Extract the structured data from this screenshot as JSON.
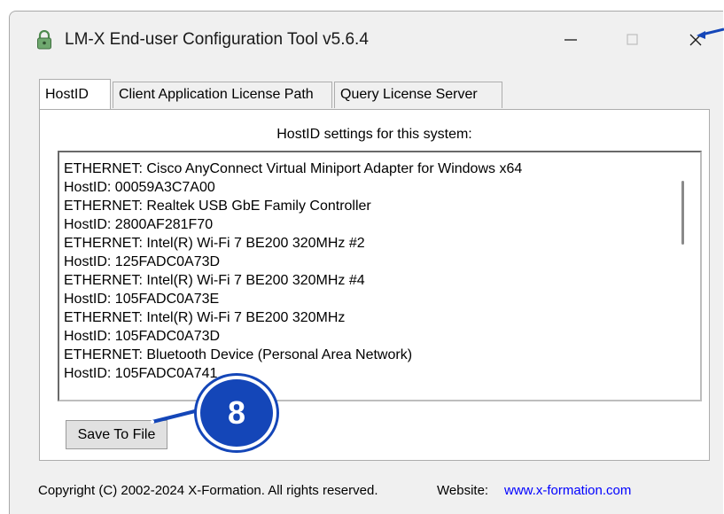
{
  "window": {
    "title": "LM-X End-user Configuration Tool v5.6.4"
  },
  "tabs": [
    {
      "label": "HostID",
      "active": true
    },
    {
      "label": "Client Application License Path",
      "active": false
    },
    {
      "label": "Query License Server",
      "active": false
    }
  ],
  "hostid_panel": {
    "heading": "HostID settings for this system:",
    "lines": [
      "ETHERNET: Cisco AnyConnect Virtual Miniport Adapter for Windows x64",
      "HostID: 00059A3C7A00",
      "ETHERNET: Realtek USB GbE Family Controller",
      "HostID: 2800AF281F70",
      "ETHERNET: Intel(R) Wi-Fi 7 BE200 320MHz #2",
      "HostID: 125FADC0A73D",
      "ETHERNET: Intel(R) Wi-Fi 7 BE200 320MHz #4",
      "HostID: 105FADC0A73E",
      "ETHERNET: Intel(R) Wi-Fi 7 BE200 320MHz",
      "HostID: 105FADC0A73D",
      "ETHERNET: Bluetooth Device (Personal Area Network)",
      "HostID: 105FADC0A741"
    ],
    "save_button_label": "Save To File"
  },
  "footer": {
    "copyright": "Copyright (C) 2002-2024 X-Formation. All rights reserved.",
    "website_label": "Website:",
    "website_link": "www.x-formation.com"
  },
  "callout": {
    "number": "8"
  },
  "colors": {
    "callout": "#1446b8",
    "link": "#0000ff",
    "window_bg": "#f0f0f0"
  }
}
